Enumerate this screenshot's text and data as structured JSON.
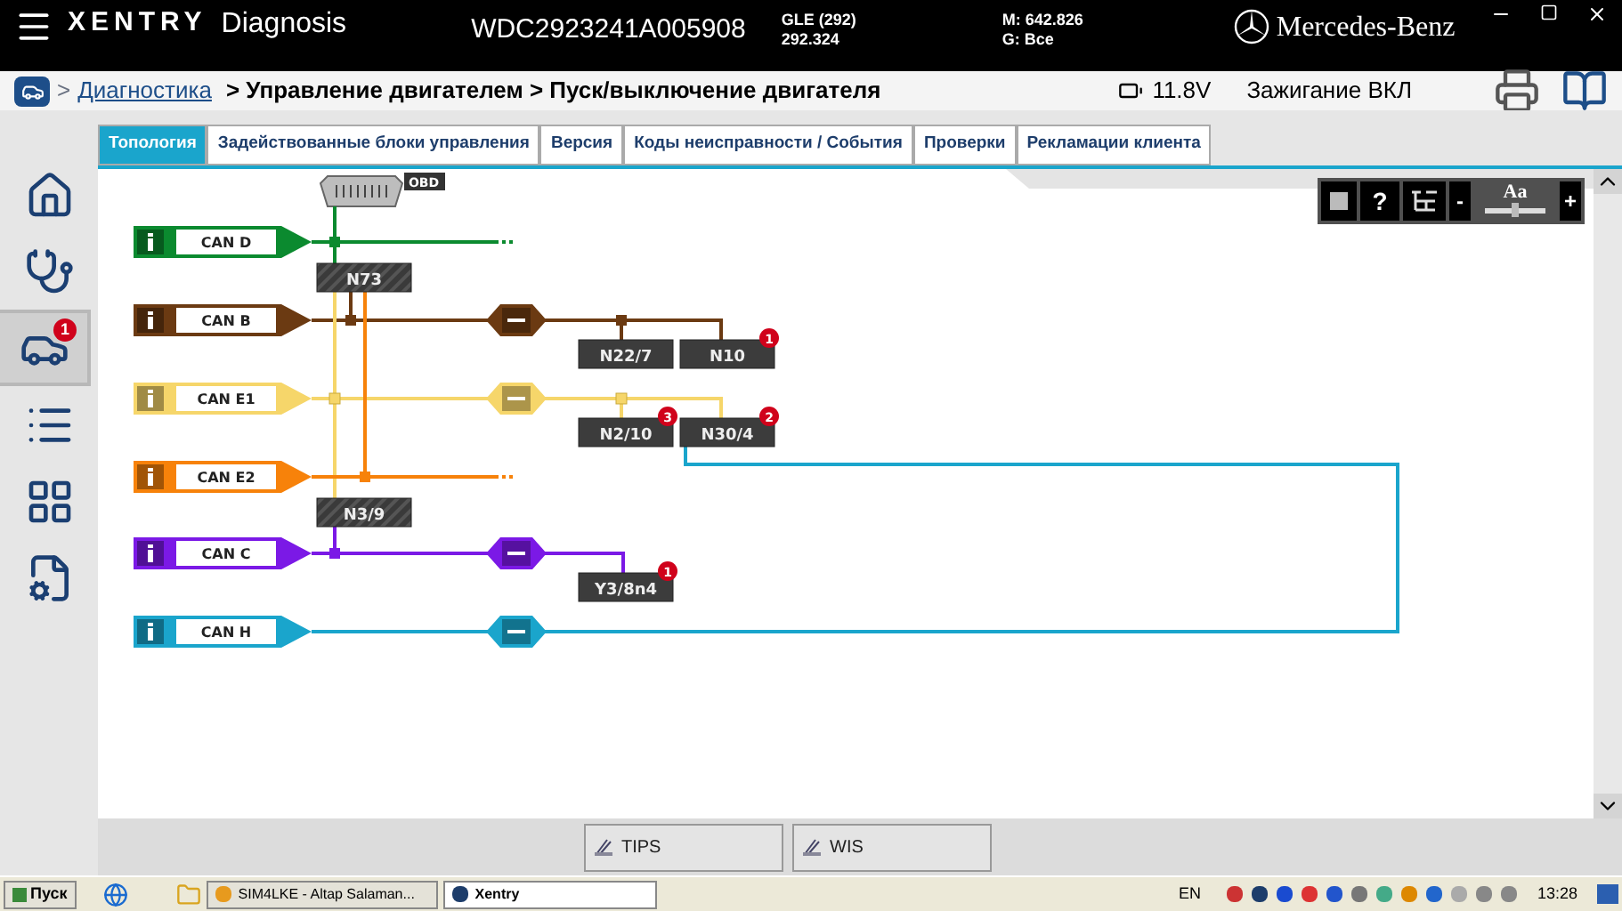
{
  "header": {
    "logo": "XENTRY",
    "app": "Diagnosis",
    "vin": "WDC2923241A005908",
    "model": [
      "GLE (292)",
      "292.324"
    ],
    "engine": [
      "M: 642.826",
      "G: Все"
    ],
    "brand": "Mercedes-Benz"
  },
  "breadcrumb": {
    "separator": ">",
    "link": "Диагностика",
    "path": "> Управление двигателем > Пуск/выключение двигателя",
    "voltage": "11.8V",
    "ignition": "Зажигание ВКЛ"
  },
  "sidebar": [
    {
      "kind": "home",
      "selected": false
    },
    {
      "kind": "diagnosis",
      "selected": false
    },
    {
      "kind": "faults",
      "selected": true,
      "badge": "1"
    },
    {
      "kind": "list",
      "selected": false
    },
    {
      "kind": "modules",
      "selected": false
    },
    {
      "kind": "service",
      "selected": false
    }
  ],
  "tabs": [
    {
      "label": "Топология",
      "selected": true
    },
    {
      "label": "Задействованные блоки управления",
      "selected": false
    },
    {
      "label": "Версия",
      "selected": false
    },
    {
      "label": "Коды неисправности / События",
      "selected": false
    },
    {
      "label": "Проверки",
      "selected": false
    },
    {
      "label": "Рекламации клиента",
      "selected": false
    }
  ],
  "toolbar": {
    "help": "?",
    "minus": "-",
    "font": "Aa",
    "plus": "+",
    "level": 0.5
  },
  "topology": {
    "obd": "OBD",
    "buses": [
      {
        "name": "CAN D",
        "color": "#0b8a2f",
        "gateway": false
      },
      {
        "name": "CAN B",
        "color": "#6b3a12",
        "gateway": true
      },
      {
        "name": "CAN E1",
        "color": "#f6d66a",
        "gateway": true
      },
      {
        "name": "CAN E2",
        "color": "#f7820a",
        "gateway": false
      },
      {
        "name": "CAN C",
        "color": "#7b19e6",
        "gateway": true
      },
      {
        "name": "CAN H",
        "color": "#1aa5cc",
        "gateway": true
      }
    ],
    "modules": [
      {
        "name": "N73",
        "kind": "central"
      },
      {
        "name": "N22/7",
        "kind": "module"
      },
      {
        "name": "N10",
        "kind": "module",
        "badge": "1"
      },
      {
        "name": "N2/10",
        "kind": "module",
        "badge": "3"
      },
      {
        "name": "N30/4",
        "kind": "module",
        "badge": "2"
      },
      {
        "name": "N3/9",
        "kind": "central"
      },
      {
        "name": "Y3/8n4",
        "kind": "module",
        "badge": "1"
      }
    ]
  },
  "bottom_buttons": [
    {
      "label": "TIPS"
    },
    {
      "label": "WIS"
    }
  ],
  "taskbar": {
    "start": "Пуск",
    "tasks": [
      {
        "label": "SIM4LKE - Altap Salaman...",
        "selected": false
      },
      {
        "label": "Xentry",
        "selected": true
      }
    ],
    "language": "EN",
    "clock": "13:28"
  }
}
